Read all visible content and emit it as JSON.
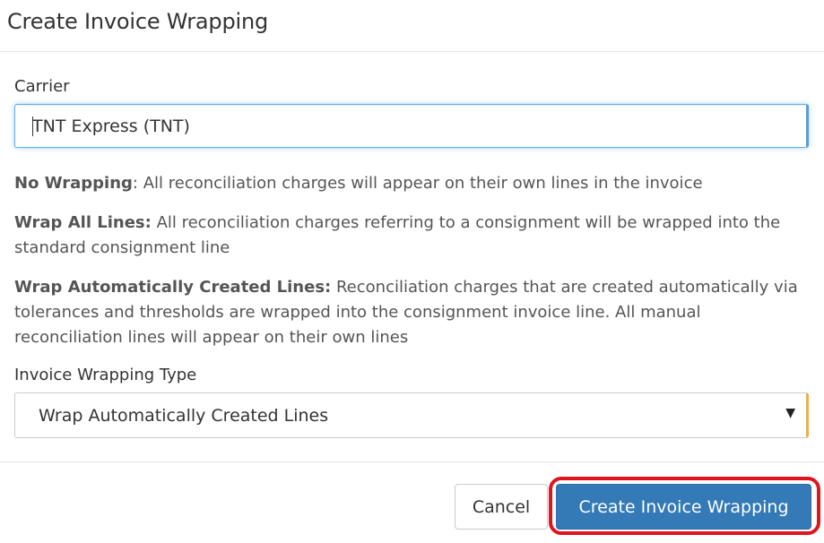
{
  "dialog": {
    "title": "Create Invoice Wrapping"
  },
  "carrier": {
    "label": "Carrier",
    "value": "TNT Express (TNT)"
  },
  "descriptions": [
    {
      "term": "No Wrapping",
      "text": "All reconciliation charges will appear on their own lines in the invoice"
    },
    {
      "term": "Wrap All Lines:",
      "text": "All reconciliation charges referring to a consignment will be wrapped into the standard consignment line"
    },
    {
      "term": "Wrap Automatically Created Lines:",
      "text": "Reconciliation charges that are created automatically via tolerances and thresholds are wrapped into the consignment invoice line. All manual reconciliation lines will appear on their own lines"
    }
  ],
  "wrapping_type": {
    "label": "Invoice Wrapping Type",
    "selected": "Wrap Automatically Created Lines"
  },
  "footer": {
    "cancel_label": "Cancel",
    "create_label": "Create Invoice Wrapping"
  },
  "colors": {
    "primary": "#337ab7",
    "highlight": "#e0141e",
    "focus_border": "#66afe9",
    "select_accent": "#f0ad4e"
  },
  "icons": {
    "select_arrow": "dropdown-arrow-icon"
  }
}
